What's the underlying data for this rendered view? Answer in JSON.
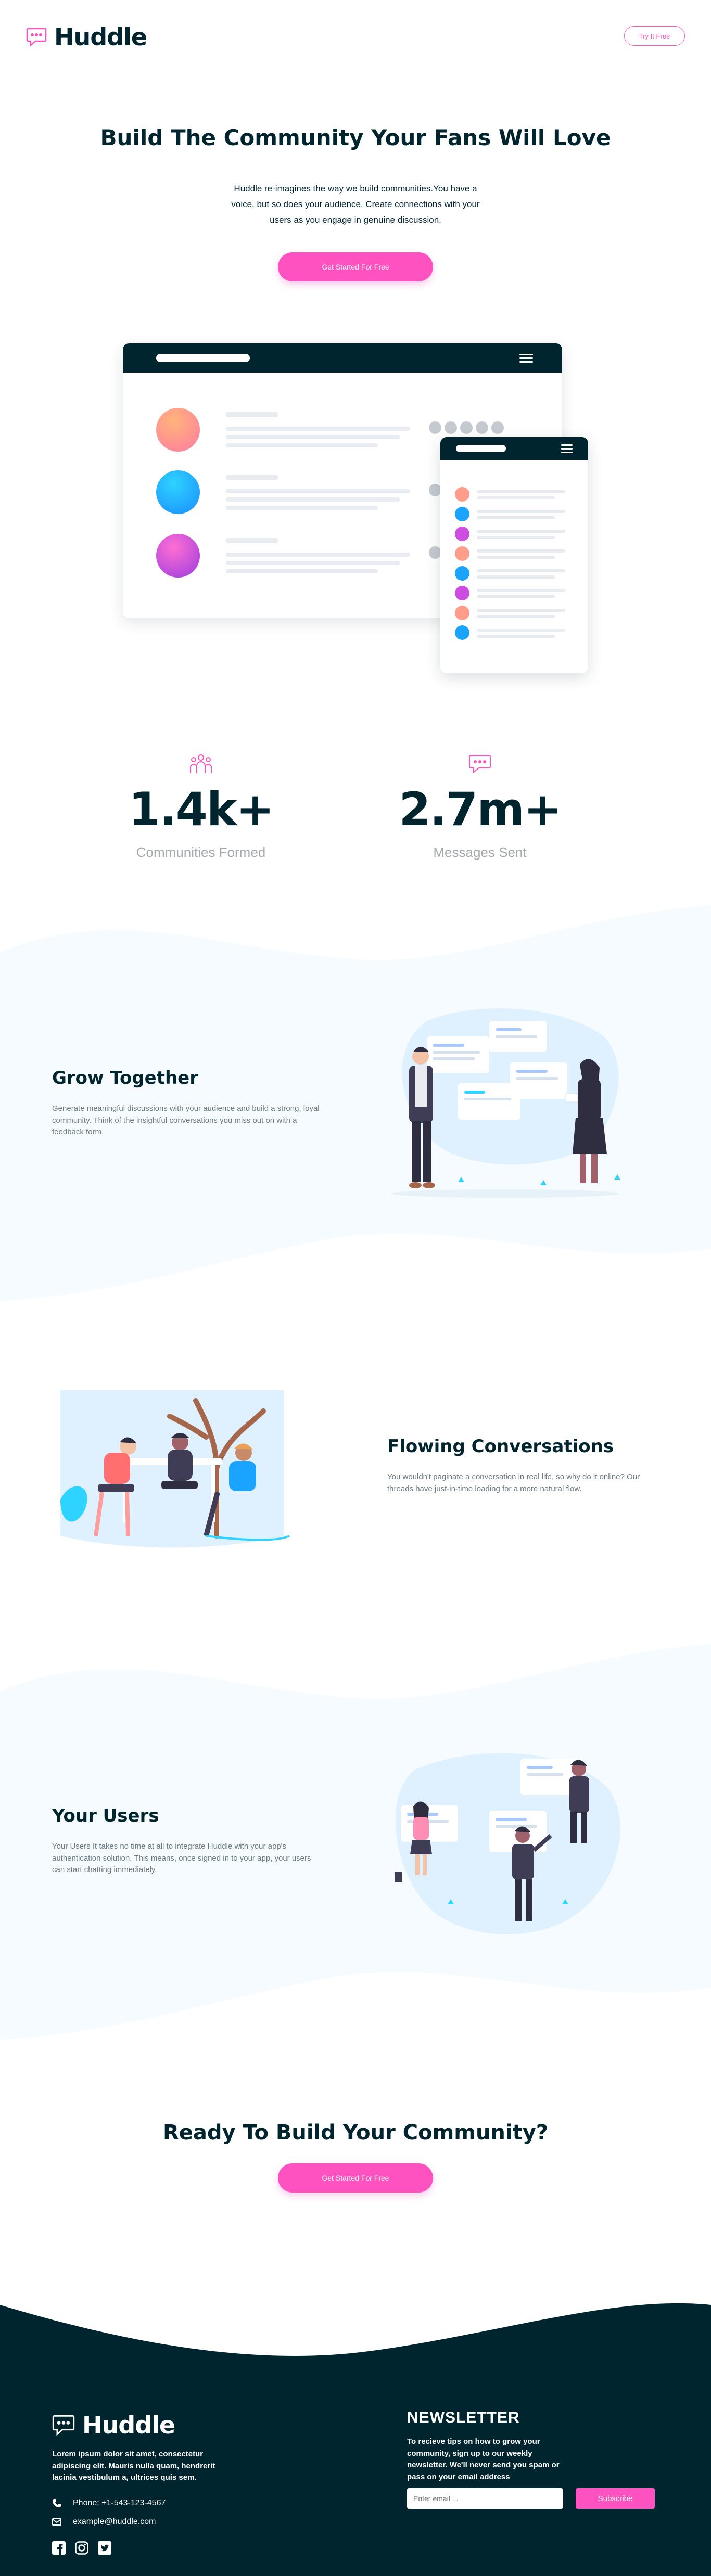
{
  "header": {
    "brand": "Huddle",
    "try_button": "Try It Free"
  },
  "hero": {
    "title": "Build The Community Your Fans Will Love",
    "subtitle": "Huddle re-imagines the way we build communities.You have a voice, but so does your audience. Create connections with your users as you engage in genuine discussion.",
    "cta": "Get Started For Free"
  },
  "stats": [
    {
      "icon": "communities-icon",
      "value": "1.4k+",
      "label": "Communities Formed"
    },
    {
      "icon": "messages-icon",
      "value": "2.7m+",
      "label": "Messages Sent"
    }
  ],
  "features": [
    {
      "title": "Grow Together",
      "text": "Generate meaningful discussions with your audience and build a strong, loyal community. Think of the insightful conversations you miss out on with a feedback form."
    },
    {
      "title": "Flowing Conversations",
      "text": "You wouldn't paginate a conversation in real life, so why do it online? Our threads have just-in-time loading for a more natural flow."
    },
    {
      "title": "Your Users",
      "text": "Your Users It takes no time at all to integrate Huddle with your app's authentication solution. This means, once signed in to your app, your users can start chatting immediately."
    }
  ],
  "cta_section": {
    "title": "Ready To Build Your Community?",
    "button": "Get Started For Free"
  },
  "footer": {
    "brand": "Huddle",
    "about": "Lorem ipsum dolor sit amet, consectetur adipiscing elit. Mauris nulla quam, hendrerit lacinia vestibulum a, ultrices quis sem.",
    "phone": "Phone: +1-543-123-4567",
    "email": "example@huddle.com",
    "socials": [
      "facebook-icon",
      "instagram-icon",
      "twitter-icon"
    ],
    "newsletter": {
      "title": "NEWSLETTER",
      "text": "To recieve tips on how to grow your community, sign up to our weekly newsletter. We'll never send you spam or pass on your email address",
      "placeholder": "Enter email ...",
      "button": "Subscribe"
    }
  },
  "colors": {
    "brand_pink": "#ff52c1",
    "dark_blue": "#00252e",
    "light_blue_bg": "#f5fbff"
  }
}
